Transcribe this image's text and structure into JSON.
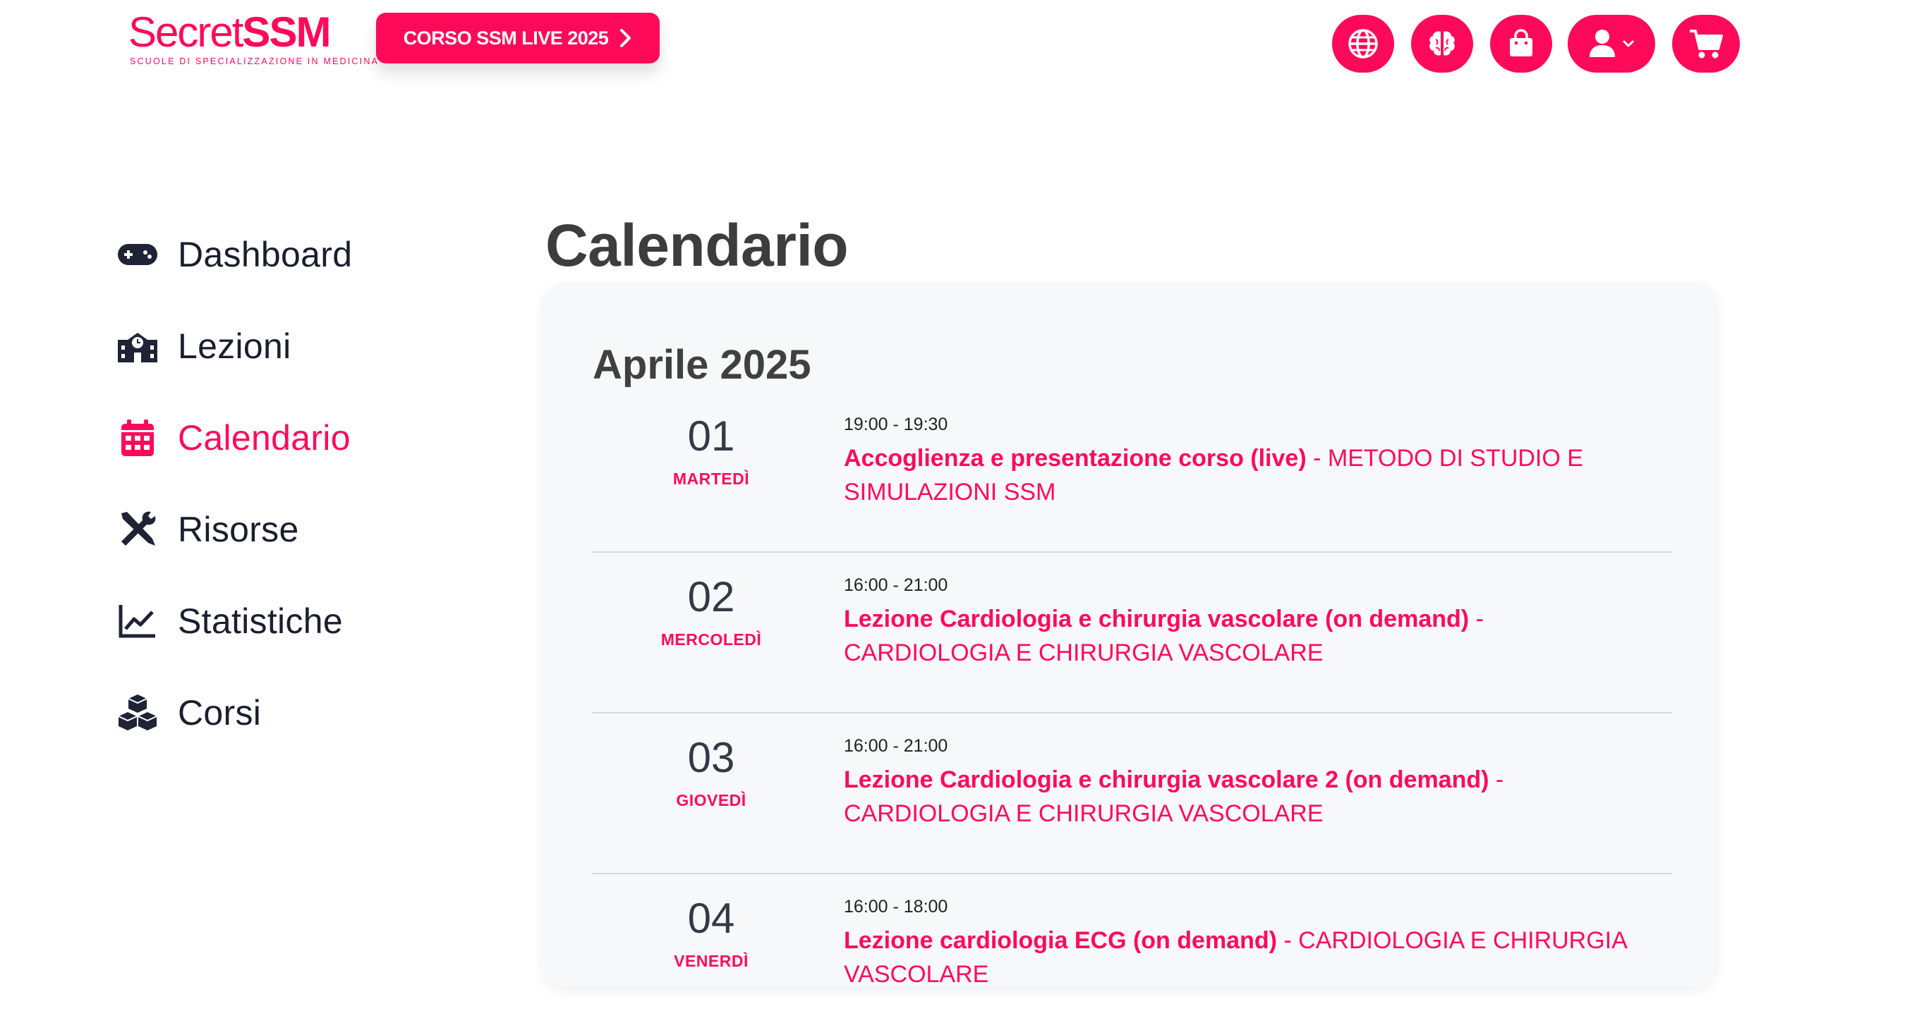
{
  "header": {
    "logo_light": "Secret",
    "logo_bold": "SSM",
    "logo_subtitle": "SCUOLE DI SPECIALIZZAZIONE IN MEDICINA",
    "cta_label": "CORSO SSM LIVE 2025",
    "icons": [
      "globe-icon",
      "brain-icon",
      "shopping-bag-icon",
      "user-icon",
      "chevron-down-icon",
      "cart-icon"
    ]
  },
  "sidebar": {
    "items": [
      {
        "label": "Dashboard",
        "icon": "gamepad-icon"
      },
      {
        "label": "Lezioni",
        "icon": "school-icon"
      },
      {
        "label": "Calendario",
        "icon": "calendar-icon",
        "active": true
      },
      {
        "label": "Risorse",
        "icon": "tools-icon"
      },
      {
        "label": "Statistiche",
        "icon": "chart-line-icon"
      },
      {
        "label": "Corsi",
        "icon": "cubes-icon"
      }
    ]
  },
  "main": {
    "title": "Calendario",
    "month": "Aprile 2025",
    "events": [
      {
        "day": "01",
        "weekday": "MARTEDÌ",
        "time": "19:00 - 19:30",
        "title": "Accoglienza e presentazione corso (live)",
        "sep": " - ",
        "category": "METODO DI STUDIO E SIMULAZIONI SSM"
      },
      {
        "day": "02",
        "weekday": "MERCOLEDÌ",
        "time": "16:00 - 21:00",
        "title": "Lezione Cardiologia e chirurgia vascolare (on demand)",
        "sep": " - ",
        "category": "CARDIOLOGIA E CHIRURGIA VASCOLARE"
      },
      {
        "day": "03",
        "weekday": "GIOVEDÌ",
        "time": "16:00 - 21:00",
        "title": "Lezione Cardiologia e chirurgia vascolare 2 (on demand)",
        "sep": " - ",
        "category": "CARDIOLOGIA E CHIRURGIA VASCOLARE"
      },
      {
        "day": "04",
        "weekday": "VENERDÌ",
        "time": "16:00 - 18:00",
        "title": "Lezione cardiologia ECG (on demand)",
        "sep": " - ",
        "category": "CARDIOLOGIA E CHIRURGIA VASCOLARE"
      }
    ]
  },
  "colors": {
    "brand": "#ff0a5a",
    "text_dark": "#1f2335",
    "panel_bg": "#f7f8fa"
  }
}
